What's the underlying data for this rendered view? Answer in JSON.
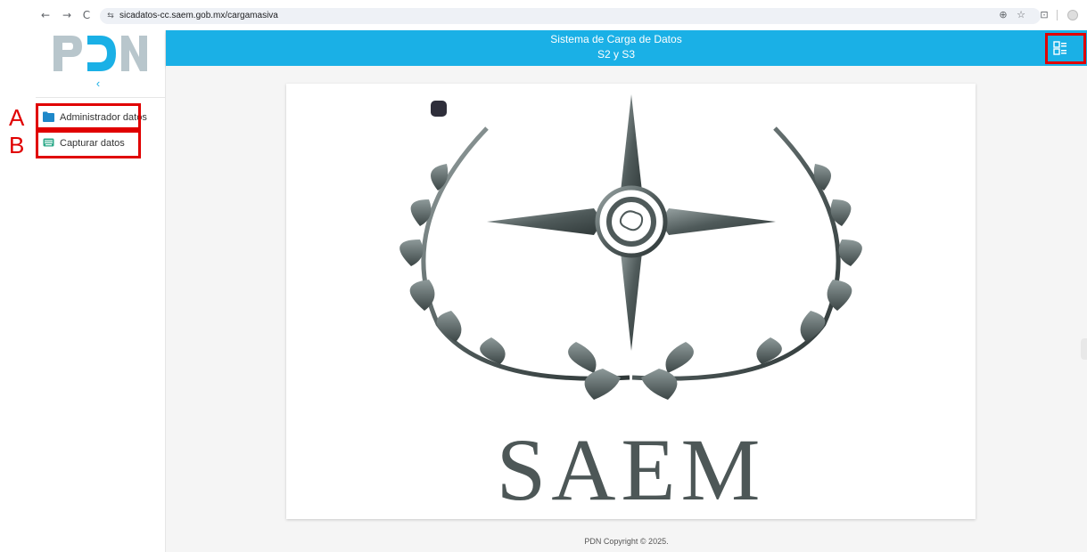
{
  "browser": {
    "url": "sicadatos-cc.saem.gob.mx/cargamasiva",
    "back_icon": "←",
    "forward_icon": "→",
    "reload_icon": "C",
    "site_info_icon": "⇆",
    "key_icon": "⊕",
    "star_icon": "☆",
    "extensions_icon": "⊡"
  },
  "sidebar": {
    "logo_text": "PDN",
    "collapse_icon": "‹",
    "items": [
      {
        "label": "Administrador datos",
        "icon": "folder-icon"
      },
      {
        "label": "Capturar datos",
        "icon": "keyboard-icon"
      }
    ]
  },
  "header": {
    "title": "Sistema de Carga de Datos",
    "subtitle": "S2 y S3",
    "menu_icon": "apps-menu-icon"
  },
  "main": {
    "logo_text": "SAEM"
  },
  "footer": {
    "text": "PDN Copyright © 2025."
  },
  "annotations": {
    "labels": [
      "A",
      "B"
    ],
    "color": "#e00000"
  },
  "colors": {
    "accent": "#1ab0e6",
    "logo_gray": "#b8c6cc",
    "logo_dark": "#3f4a4a"
  }
}
